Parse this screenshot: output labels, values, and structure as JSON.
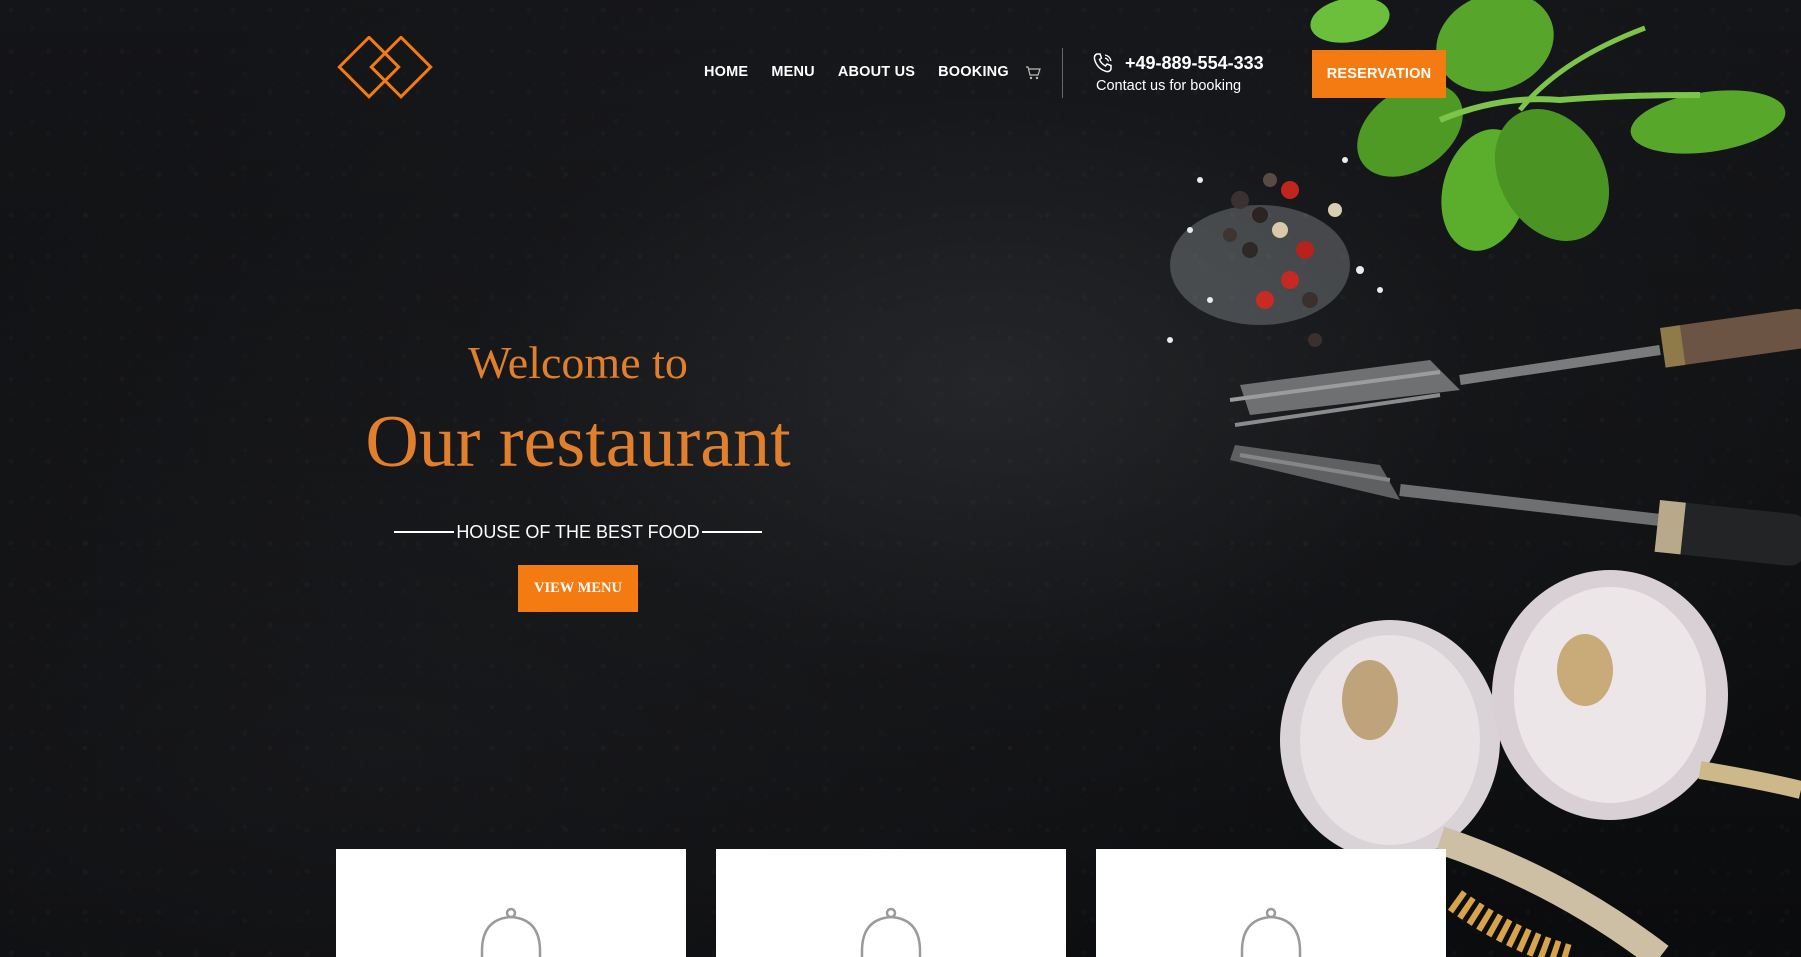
{
  "header": {
    "nav": [
      "HOME",
      "MENU",
      "ABOUT US",
      "BOOKING"
    ],
    "cart_icon": "cart-icon",
    "phone_icon": "phone-icon",
    "phone_number": "+49-889-554-333",
    "phone_caption": "Contact us for booking",
    "reservation_label": "RESERVATION"
  },
  "hero": {
    "welcome": "Welcome to",
    "title": "Our restaurant",
    "tagline": "HOUSE OF THE BEST FOOD",
    "button_label": "VIEW MENU"
  },
  "cards": [
    {
      "icon": "cloche-icon"
    },
    {
      "icon": "cloche-icon"
    },
    {
      "icon": "cloche-icon"
    }
  ],
  "colors": {
    "accent": "#f47b12",
    "heading": "#e07f2c",
    "background": "#111214"
  }
}
